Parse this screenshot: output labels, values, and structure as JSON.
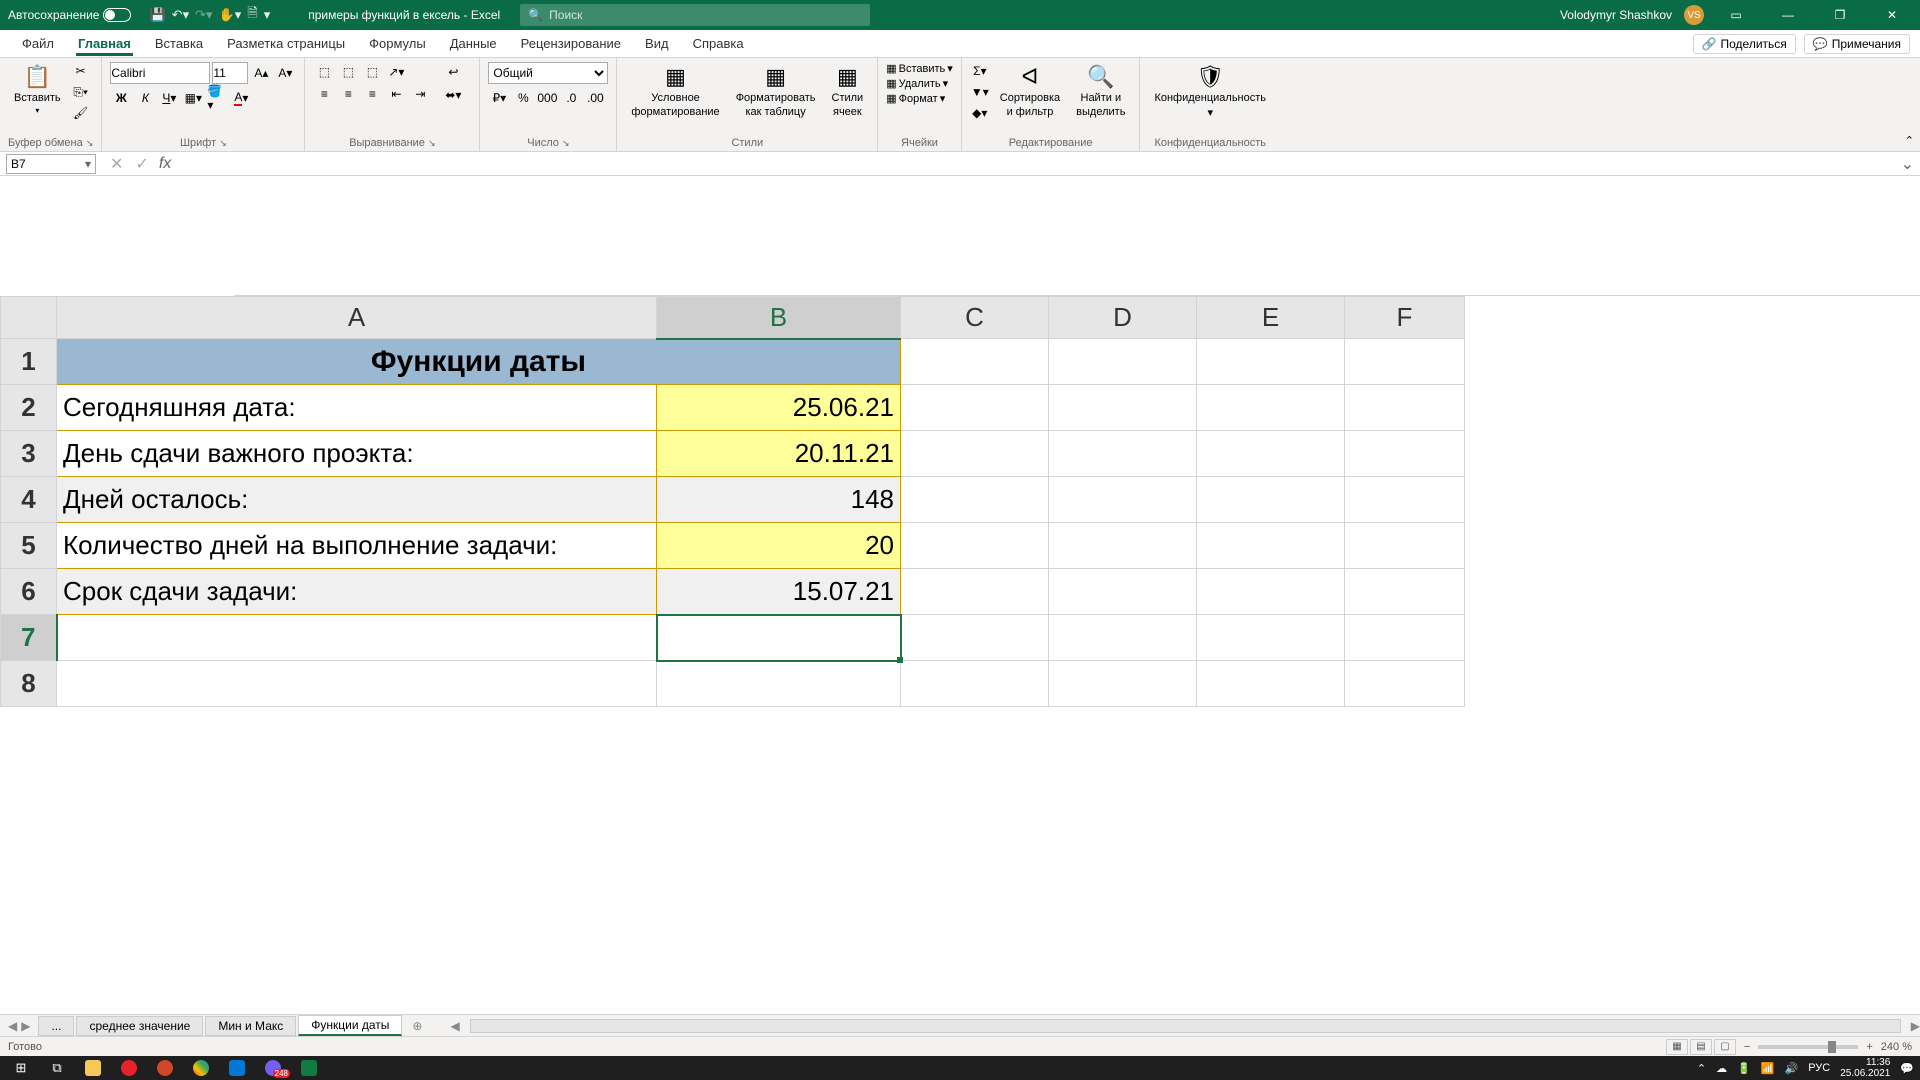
{
  "titlebar": {
    "autosave_label": "Автосохранение",
    "doc_name": "примеры функций в ексель",
    "app_name": "Excel",
    "search_placeholder": "Поиск",
    "user_name": "Volodymyr Shashkov",
    "user_initials": "VS"
  },
  "tabs": {
    "file": "Файл",
    "home": "Главная",
    "insert": "Вставка",
    "layout": "Разметка страницы",
    "formulas": "Формулы",
    "data": "Данные",
    "review": "Рецензирование",
    "view": "Вид",
    "help": "Справка",
    "share": "Поделиться",
    "comments": "Примечания"
  },
  "ribbon": {
    "clipboard": {
      "paste": "Вставить",
      "label": "Буфер обмена"
    },
    "font": {
      "name": "Calibri",
      "size": "11",
      "label": "Шрифт"
    },
    "align": {
      "label": "Выравнивание"
    },
    "number": {
      "format": "Общий",
      "label": "Число"
    },
    "styles": {
      "cond": "Условное",
      "cond2": "форматирование",
      "table": "Форматировать",
      "table2": "как таблицу",
      "cell": "Стили",
      "cell2": "ячеек",
      "label": "Стили"
    },
    "cells": {
      "insert": "Вставить",
      "delete": "Удалить",
      "format": "Формат",
      "label": "Ячейки"
    },
    "editing": {
      "sort": "Сортировка",
      "sort2": "и фильтр",
      "find": "Найти и",
      "find2": "выделить",
      "label": "Редактирование"
    },
    "sens": {
      "label1": "Конфиденциальность",
      "label": "Конфиденциальность"
    }
  },
  "formula_bar": {
    "cell_ref": "B7",
    "formula": ""
  },
  "columns": [
    "A",
    "B",
    "C",
    "D",
    "E",
    "F"
  ],
  "rows": [
    "1",
    "2",
    "3",
    "4",
    "5",
    "6",
    "7",
    "8"
  ],
  "sheet": {
    "title": "Функции даты",
    "r2a": "Сегодняшняя дата:",
    "r2b": "25.06.21",
    "r3a": "День сдачи важного проэкта:",
    "r3b": "20.11.21",
    "r4a": "Дней осталось:",
    "r4b": "148",
    "r5a": "Количество дней на выполнение задачи:",
    "r5b": "20",
    "r6a": "Срок сдачи задачи:",
    "r6b": "15.07.21"
  },
  "sheet_tabs": {
    "dots": "...",
    "t1": "среднее значение",
    "t2": "Мин и Макс",
    "t3": "Функции даты"
  },
  "status": {
    "ready": "Готово",
    "zoom": "240 %"
  },
  "taskbar": {
    "lang": "РУС",
    "time": "11:36",
    "date": "25.06.2021",
    "viber_badge": "248"
  }
}
